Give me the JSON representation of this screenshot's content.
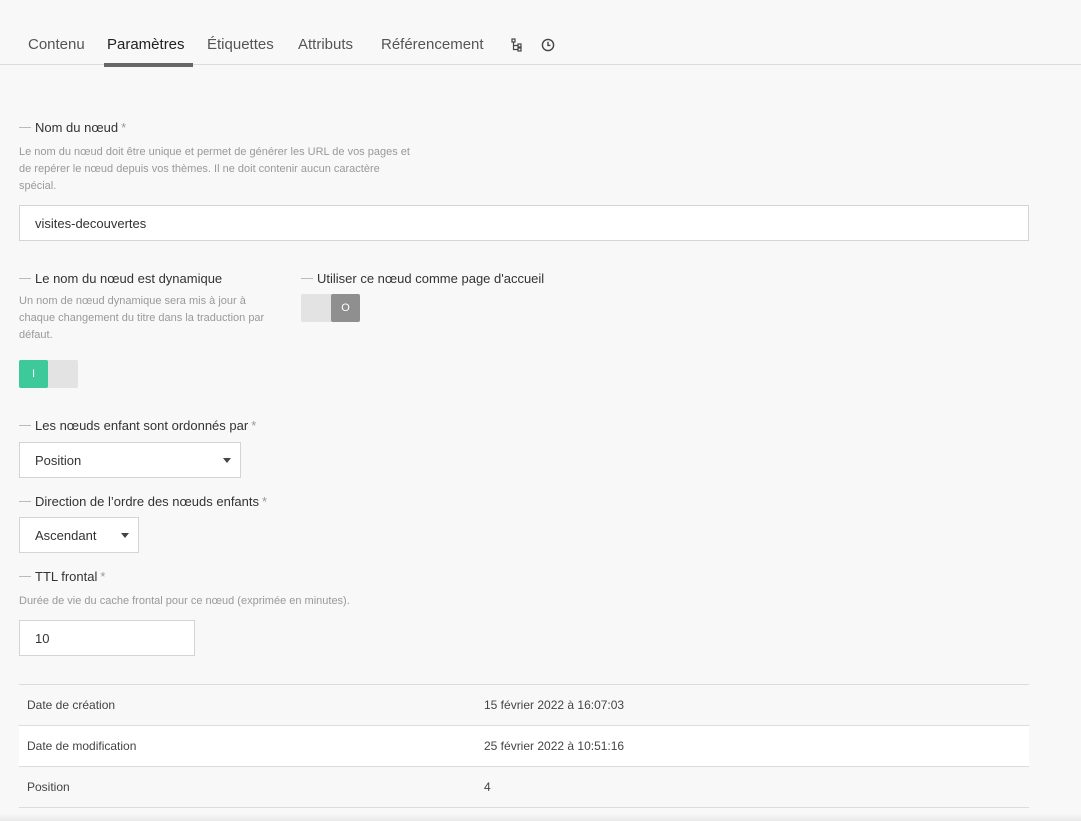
{
  "tabs": [
    {
      "label": "Contenu"
    },
    {
      "label": "Paramètres",
      "active": true
    },
    {
      "label": "Étiquettes"
    },
    {
      "label": "Attributs"
    },
    {
      "label": "Référencement"
    }
  ],
  "tab_icons": [
    "tree-icon",
    "history-clock-icon"
  ],
  "node_name": {
    "label": "Nom du nœud",
    "required_mark": "*",
    "help": "Le nom du nœud doit être unique et permet de générer les URL de vos pages et de repérer le nœud depuis vos thèmes. Il ne doit contenir aucun caractère spécial.",
    "value": "visites-decouvertes"
  },
  "dynamic_name": {
    "label": "Le nom du nœud est dynamique",
    "help": "Un nom de nœud dynamique sera mis à jour à chaque changement du titre dans la traduction par défaut.",
    "toggle_text": "I",
    "state": "on"
  },
  "home_page": {
    "label": "Utiliser ce nœud comme page d'accueil",
    "toggle_text": "O",
    "state": "off"
  },
  "children_order": {
    "label": "Les nœuds enfant sont ordonnés par",
    "required_mark": "*",
    "value": "Position"
  },
  "order_direction": {
    "label": "Direction de l’ordre des nœuds enfants",
    "required_mark": "*",
    "value": "Ascendant"
  },
  "ttl": {
    "label": "TTL frontal",
    "required_mark": "*",
    "help": "Durée de vie du cache frontal pour ce nœud (exprimée en minutes).",
    "value": "10"
  },
  "info": [
    {
      "key": "Date de création",
      "value": "15 février 2022 à 16:07:03"
    },
    {
      "key": "Date de modification",
      "value": "25 février 2022 à 10:51:16"
    },
    {
      "key": "Position",
      "value": "4"
    }
  ],
  "colors": {
    "toggle_on": "#3ec99a",
    "toggle_off": "#8f8f8f",
    "tab_indicator": "#666666"
  }
}
